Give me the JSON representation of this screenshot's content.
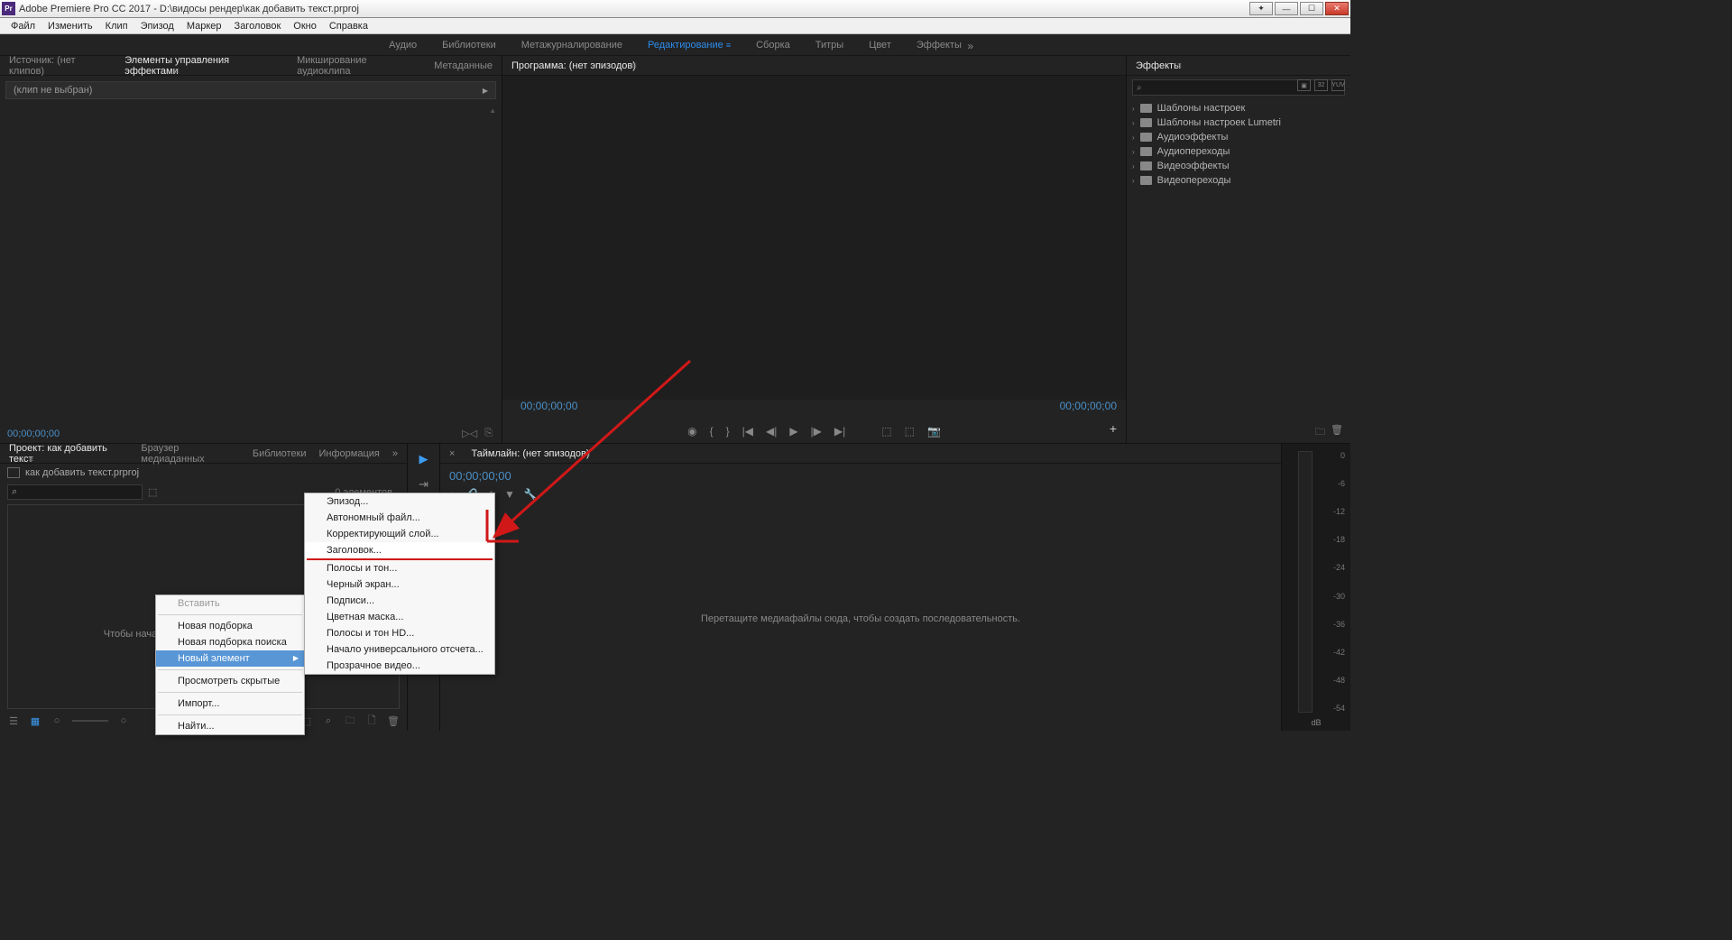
{
  "titlebar": {
    "app_label": "Pr",
    "title": "Adobe Premiere Pro CC 2017 - D:\\видосы рендер\\как добавить текст.prproj"
  },
  "menubar": {
    "items": [
      "Файл",
      "Изменить",
      "Клип",
      "Эпизод",
      "Маркер",
      "Заголовок",
      "Окно",
      "Справка"
    ]
  },
  "workspaces": {
    "items": [
      "Аудио",
      "Библиотеки",
      "Метажурналирование",
      "Редактирование",
      "Сборка",
      "Титры",
      "Цвет",
      "Эффекты"
    ],
    "active_index": 3,
    "overflow": "»"
  },
  "source_panel": {
    "tabs": [
      "Источник: (нет клипов)",
      "Элементы управления эффектами",
      "Микширование аудиоклипа",
      "Метаданные"
    ],
    "active_index": 1,
    "noclip_text": "(клип не выбран)",
    "timecode": "00;00;00;00"
  },
  "program_panel": {
    "tab": "Программа: (нет эпизодов)",
    "tc_left": "00;00;00;00",
    "tc_right": "00;00;00;00"
  },
  "effects_panel": {
    "tab": "Эффекты",
    "search_glyph": "⌕",
    "nodes": [
      "Шаблоны настроек",
      "Шаблоны настроек Lumetri",
      "Аудиоэффекты",
      "Аудиопереходы",
      "Видеоэффекты",
      "Видеопереходы"
    ]
  },
  "project_panel": {
    "tabs": [
      "Проект: как добавить текст",
      "Браузер медиаданных",
      "Библиотеки",
      "Информация"
    ],
    "active_index": 0,
    "overflow": "»",
    "filename": "как добавить текст.prproj",
    "count": "0 элементов",
    "drop_hint": "Чтобы начать, импортируйте медиаданные"
  },
  "timeline_panel": {
    "tab": "Таймлайн: (нет эпизодов)",
    "tc": "00;00;00;00",
    "drop_hint": "Перетащите медиафайлы сюда, чтобы создать последовательность."
  },
  "audio_meters": {
    "scale": [
      "0",
      "-6",
      "-12",
      "-18",
      "-24",
      "-30",
      "-36",
      "-42",
      "-48",
      "-54"
    ],
    "unit": "dB"
  },
  "context_menu_1": {
    "items": [
      {
        "label": "Вставить",
        "disabled": true
      },
      {
        "sep": true
      },
      {
        "label": "Новая подборка"
      },
      {
        "label": "Новая подборка поиска"
      },
      {
        "label": "Новый элемент",
        "submenu": true,
        "hover": true
      },
      {
        "sep": true
      },
      {
        "label": "Просмотреть скрытые"
      },
      {
        "sep": true
      },
      {
        "label": "Импорт..."
      },
      {
        "sep": true
      },
      {
        "label": "Найти..."
      }
    ]
  },
  "context_menu_2": {
    "items": [
      {
        "label": "Эпизод..."
      },
      {
        "label": "Автономный файл..."
      },
      {
        "label": "Корректирующий слой..."
      },
      {
        "label": "Заголовок...",
        "highlight": true
      },
      {
        "red_line": true
      },
      {
        "label": "Полосы и тон..."
      },
      {
        "label": "Черный экран..."
      },
      {
        "label": "Подписи..."
      },
      {
        "label": "Цветная маска..."
      },
      {
        "label": "Полосы и тон HD..."
      },
      {
        "label": "Начало универсального отсчета..."
      },
      {
        "label": "Прозрачное видео..."
      }
    ]
  }
}
